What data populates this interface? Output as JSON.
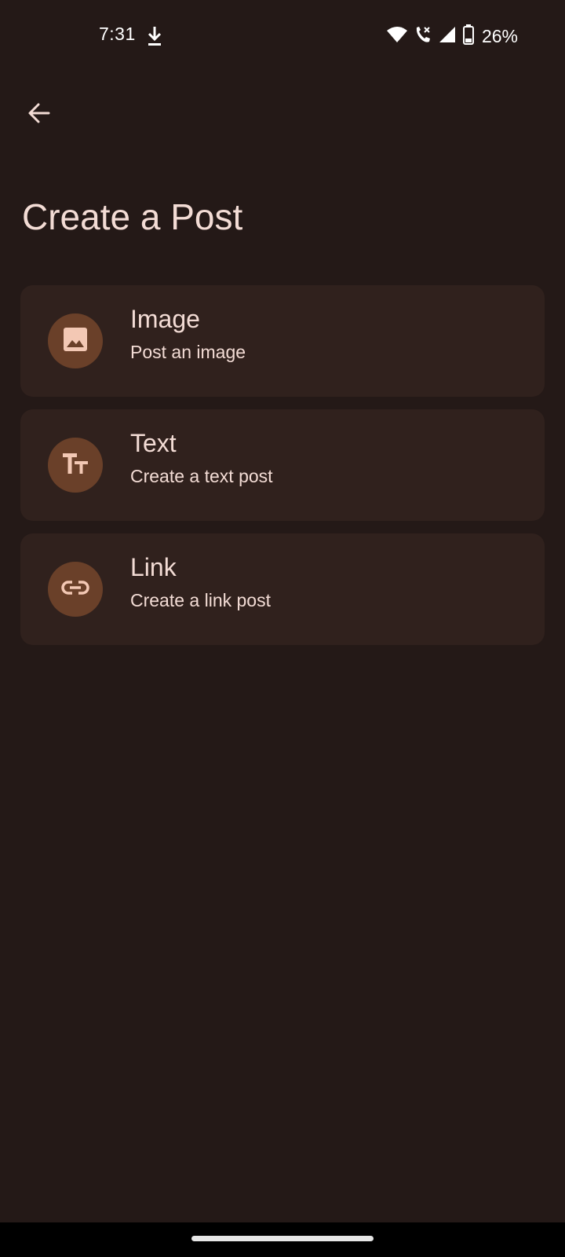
{
  "status_bar": {
    "time": "7:31",
    "battery_percent": "26%",
    "icons": [
      "download-icon",
      "wifi-icon",
      "wifi-call-icon",
      "cell-signal-icon",
      "battery-icon"
    ]
  },
  "header": {
    "back_icon": "arrow-left-icon",
    "title": "Create a Post"
  },
  "options": [
    {
      "title": "Image",
      "subtitle": "Post an image",
      "icon": "image-icon"
    },
    {
      "title": "Text",
      "subtitle": "Create a text post",
      "icon": "text-fields-icon"
    },
    {
      "title": "Link",
      "subtitle": "Create a link post",
      "icon": "link-icon"
    }
  ],
  "colors": {
    "background": "#241917",
    "card": "#30211d",
    "icon_circle": "#6a4029",
    "icon_glyph": "#f3c8b4",
    "text": "#f3dcd5"
  }
}
